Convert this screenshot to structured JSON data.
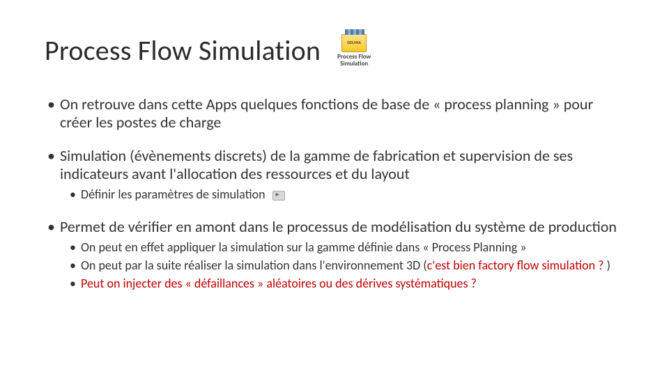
{
  "title": "Process Flow Simulation",
  "badge": {
    "line1": "Process Flow",
    "line2": "Simulation",
    "icon_label": "DELMIA"
  },
  "bullets": [
    {
      "text": "On retrouve dans cette Apps quelques fonctions de base de « process planning » pour créer les postes de charge",
      "sub": []
    },
    {
      "text": "Simulation (évènements discrets) de la gamme de fabrication et supervision de ses indicateurs avant l'allocation des ressources et du layout",
      "sub": [
        {
          "text": "Définir les paramètres de simulation",
          "has_icon": true
        }
      ]
    },
    {
      "text": "Permet de vérifier en amont dans le processus de modélisation du système de production",
      "sub": [
        {
          "text": "On peut en effet appliquer la simulation sur la gamme définie dans « Process Planning »"
        },
        {
          "prefix": "On peut par la suite réaliser la simulation dans l'environnement 3D (",
          "red": "c'est bien factory flow simulation ?",
          "suffix": " )"
        },
        {
          "red_full": "Peut on injecter des « défaillances » aléatoires  ou des dérives systématiques ?"
        }
      ]
    }
  ]
}
